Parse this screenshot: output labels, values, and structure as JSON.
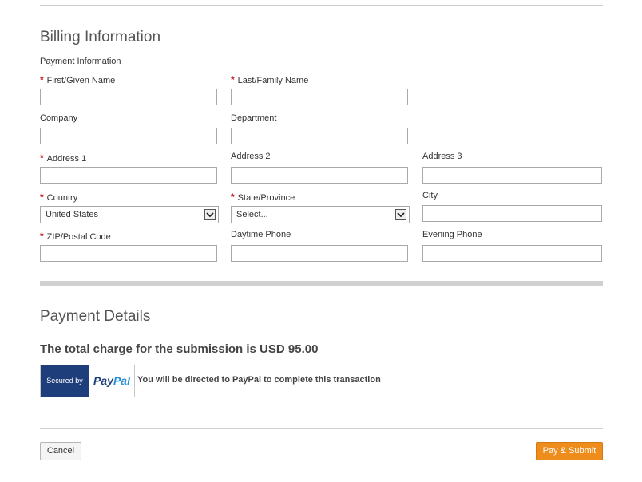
{
  "billing": {
    "title": "Billing Information",
    "subtitle": "Payment Information",
    "required_mark": "*",
    "fields": {
      "first_name": {
        "label": "First/Given Name",
        "value": ""
      },
      "last_name": {
        "label": "Last/Family Name",
        "value": ""
      },
      "company": {
        "label": "Company",
        "value": ""
      },
      "department": {
        "label": "Department",
        "value": ""
      },
      "address1": {
        "label": "Address 1",
        "value": ""
      },
      "address2": {
        "label": "Address 2",
        "value": ""
      },
      "address3": {
        "label": "Address 3",
        "value": ""
      },
      "country": {
        "label": "Country",
        "value": "United States"
      },
      "state": {
        "label": "State/Province",
        "value": "Select..."
      },
      "city": {
        "label": "City",
        "value": ""
      },
      "zip": {
        "label": "ZIP/Postal Code",
        "value": ""
      },
      "day_phone": {
        "label": "Daytime Phone",
        "value": ""
      },
      "eve_phone": {
        "label": "Evening Phone",
        "value": ""
      }
    }
  },
  "payment": {
    "title": "Payment Details",
    "total_text": "The total charge for the submission is USD 95.00",
    "badge_secured": "Secured by",
    "badge_pay": "Pay",
    "badge_pal": "Pal",
    "note": "You will be directed to PayPal to complete this transaction"
  },
  "actions": {
    "cancel_label": "Cancel",
    "submit_label": "Pay & Submit"
  },
  "colors": {
    "accent": "#ee8d1c",
    "paypal_dark": "#1e3d7b",
    "paypal_light": "#2790d7",
    "required": "#cc2222"
  }
}
